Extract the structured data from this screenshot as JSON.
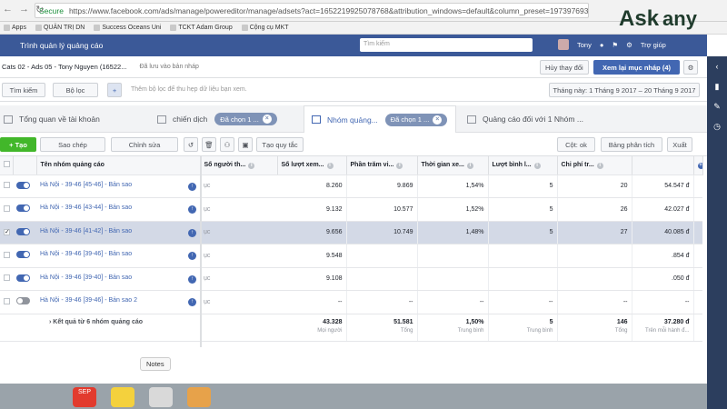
{
  "browser": {
    "secure": "Secure",
    "url": "https://www.facebook.com/ads/manage/powereditor/manage/adsets?act=1652219925078768&attribution_windows=default&column_preset=1973976932891"
  },
  "bookmarks": [
    "Apps",
    "QUẢN TRỊ DN",
    "Success Oceans Uni",
    "TCKT Adam Group",
    "Cộng cụ MKT"
  ],
  "logo": {
    "ask": "Ask",
    "any": "any"
  },
  "fb": {
    "title": "Trình quản lý quảng cáo",
    "search_placeholder": "Tìm kiếm",
    "user": "Tony",
    "help": "Trợ giúp"
  },
  "topbar": {
    "campaign": "Cats 02 - Ads 05 - Tony Nguyen (16522...",
    "saved": "Đã lưu vào bản nháp",
    "discard": "Hủy thay đổi",
    "review": "Xem lại mục nháp (4)"
  },
  "filterbar": {
    "search": "Tìm kiếm",
    "filter": "Bộ lọc",
    "hint": "Thêm bộ lọc để thu hẹp dữ liệu bạn xem.",
    "date": "Tháng này: 1 Tháng 9 2017 – 20 Tháng 9 2017"
  },
  "tabs": {
    "overview": "Tổng quan về tài khoản",
    "campaigns": "chiến dịch",
    "campaigns_chip": "Đã chọn 1 ...",
    "adsets": "Nhóm quảng...",
    "adsets_chip": "Đã chọn 1 ...",
    "ads": "Quảng cáo đối với 1 Nhóm ..."
  },
  "toolbar": {
    "create": "Tạo",
    "copy": "Sao chép",
    "edit": "Chỉnh sửa",
    "rule": "Tạo quy tắc",
    "columns": "Cột: ok",
    "breakdown": "Bảng phân tích",
    "export": "Xuất"
  },
  "table": {
    "headers": [
      "Tên nhóm quảng cáo",
      "Số người th...",
      "Số lượt xem...",
      "Phần trăm vi...",
      "Thời gian xe...",
      "Lượt bình l...",
      "Chi phí tr..."
    ],
    "rows": [
      {
        "name": "Hà Nội - 39-46 [45-46] - Bản sao",
        "c1": "ục",
        "v1": "8.260",
        "v2": "9.869",
        "v3": "1,54%",
        "v4": "5",
        "v5": "20",
        "v6": "54.547 đ",
        "check": ""
      },
      {
        "name": "Hà Nội - 39-46 [43-44] - Bản sao",
        "c1": "ục",
        "v1": "9.132",
        "v2": "10.577",
        "v3": "1,52%",
        "v4": "5",
        "v5": "26",
        "v6": "42.027 đ",
        "check": ""
      },
      {
        "name": "Hà Nội - 39-46 [41-42] - Bản sao",
        "c1": "ục",
        "v1": "9.656",
        "v2": "10.749",
        "v3": "1,48%",
        "v4": "5",
        "v5": "27",
        "v6": "40.085 đ",
        "check": "✓"
      },
      {
        "name": "Hà Nội - 39-46 [39-46] - Bản sao",
        "c1": "ục",
        "v1": "9.548",
        "v2": "",
        "v3": "",
        "v4": "",
        "v5": "",
        "v6": ".854 đ",
        "check": ""
      },
      {
        "name": "Hà Nội - 39-46 [39-40] - Bản sao",
        "c1": "ục",
        "v1": "9.108",
        "v2": "",
        "v3": "",
        "v4": "",
        "v5": "",
        "v6": ".050 đ",
        "check": ""
      },
      {
        "name": "Hà Nội - 39-46 [39-46] - Bản sao 2",
        "c1": "ục",
        "v1": "--",
        "v2": "--",
        "v3": "--",
        "v4": "--",
        "v5": "--",
        "v6": "--",
        "check": ""
      }
    ],
    "totals": {
      "label": "Kết quả từ 6 nhóm quảng cáo",
      "v1": "43.328",
      "s1": "Mọi người",
      "v2": "51.581",
      "s2": "Tổng",
      "v3": "1,50%",
      "s3": "Trung bình",
      "v4": "5",
      "s4": "Trung bình",
      "v5": "146",
      "s5": "Tổng",
      "v6": "37.280 đ",
      "s6": "Trên mỗi hành đ..."
    }
  },
  "dock": {
    "notes": "Notes",
    "calendar": "SEP"
  }
}
